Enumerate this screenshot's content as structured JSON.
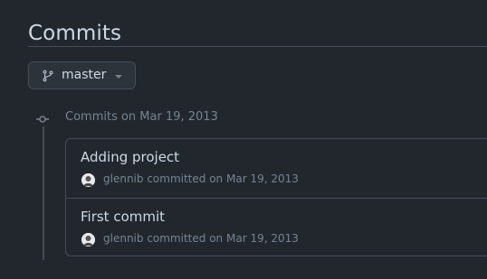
{
  "page": {
    "title": "Commits"
  },
  "branch": {
    "name": "master"
  },
  "groups": [
    {
      "title": "Commits on Mar 19, 2013",
      "commits": [
        {
          "message": "Adding project",
          "author": "glennib",
          "action": "committed on",
          "date": "Mar 19, 2013"
        },
        {
          "message": "First commit",
          "author": "glennib",
          "action": "committed on",
          "date": "Mar 19, 2013"
        }
      ]
    }
  ],
  "icons": {
    "branch": "git-branch-icon",
    "caret": "triangle-down-icon",
    "commit": "git-commit-icon",
    "avatar": "user-avatar"
  },
  "colors": {
    "background": "#22272e",
    "border": "#444c56",
    "text_primary": "#cdd9e5",
    "text_muted": "#768390"
  }
}
